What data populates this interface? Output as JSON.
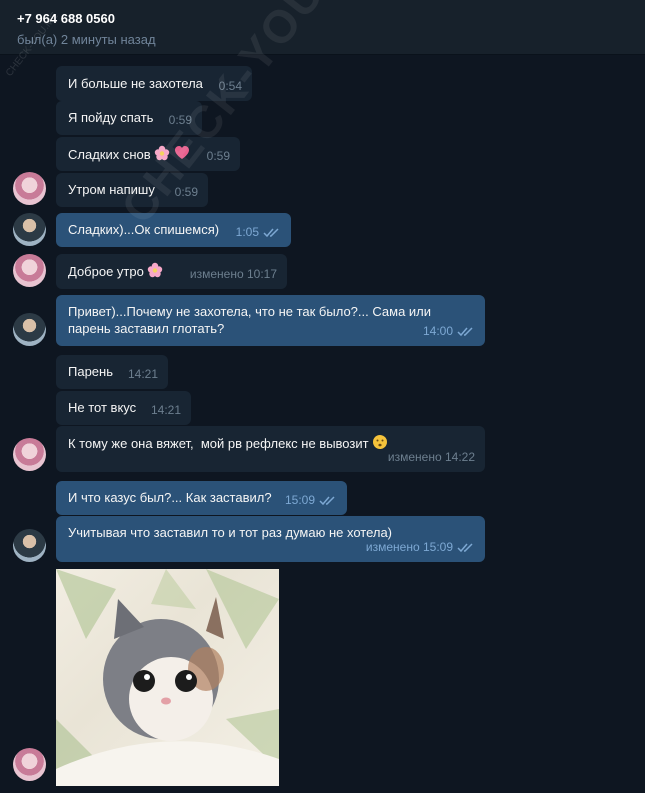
{
  "header": {
    "name": "+7 964 688 0560",
    "status": "был(а) 2 минуты назад"
  },
  "watermark": "CHECK-YOU.ME",
  "messages": [
    {
      "text": "И больше не захотела",
      "time": "0:54",
      "dir": "in"
    },
    {
      "text": "Я пойду спать",
      "time": "0:59",
      "dir": "in"
    },
    {
      "text": "Сладких снов",
      "time": "0:59",
      "dir": "in",
      "emoji": [
        "flower-emoji",
        "heart-emoji"
      ]
    },
    {
      "text": "Утром напишу",
      "time": "0:59",
      "dir": "in"
    },
    {
      "text": "Сладких)...Ок спишемся)",
      "time": "1:05",
      "dir": "out"
    },
    {
      "text": "Доброе утро",
      "time": "изменено 10:17",
      "dir": "in",
      "emoji": [
        "flower-emoji"
      ]
    },
    {
      "text": "Привет)...Почему не захотела, что не так было?... Сама или\nпарень заставил глотать?",
      "time": "14:00",
      "dir": "out"
    },
    {
      "text": "Парень",
      "time": "14:21",
      "dir": "in"
    },
    {
      "text": "Не тот вкус",
      "time": "14:21",
      "dir": "in"
    },
    {
      "text": "К тому же она вяжет,  мой рв рефлекс не вывозит",
      "time": "изменено 14:22",
      "dir": "in",
      "emoji": [
        "hush-emoji"
      ]
    },
    {
      "text": "И что казус был?... Как заставил?",
      "time": "15:09",
      "dir": "out"
    },
    {
      "text": "Учитывая что заставил то и тот раз думаю не хотела)",
      "time": "изменено 15:09",
      "dir": "out"
    }
  ],
  "colors": {
    "background": "#0e1621",
    "incoming": "#182533",
    "outgoing": "#2b5278",
    "header": "#17212b"
  }
}
